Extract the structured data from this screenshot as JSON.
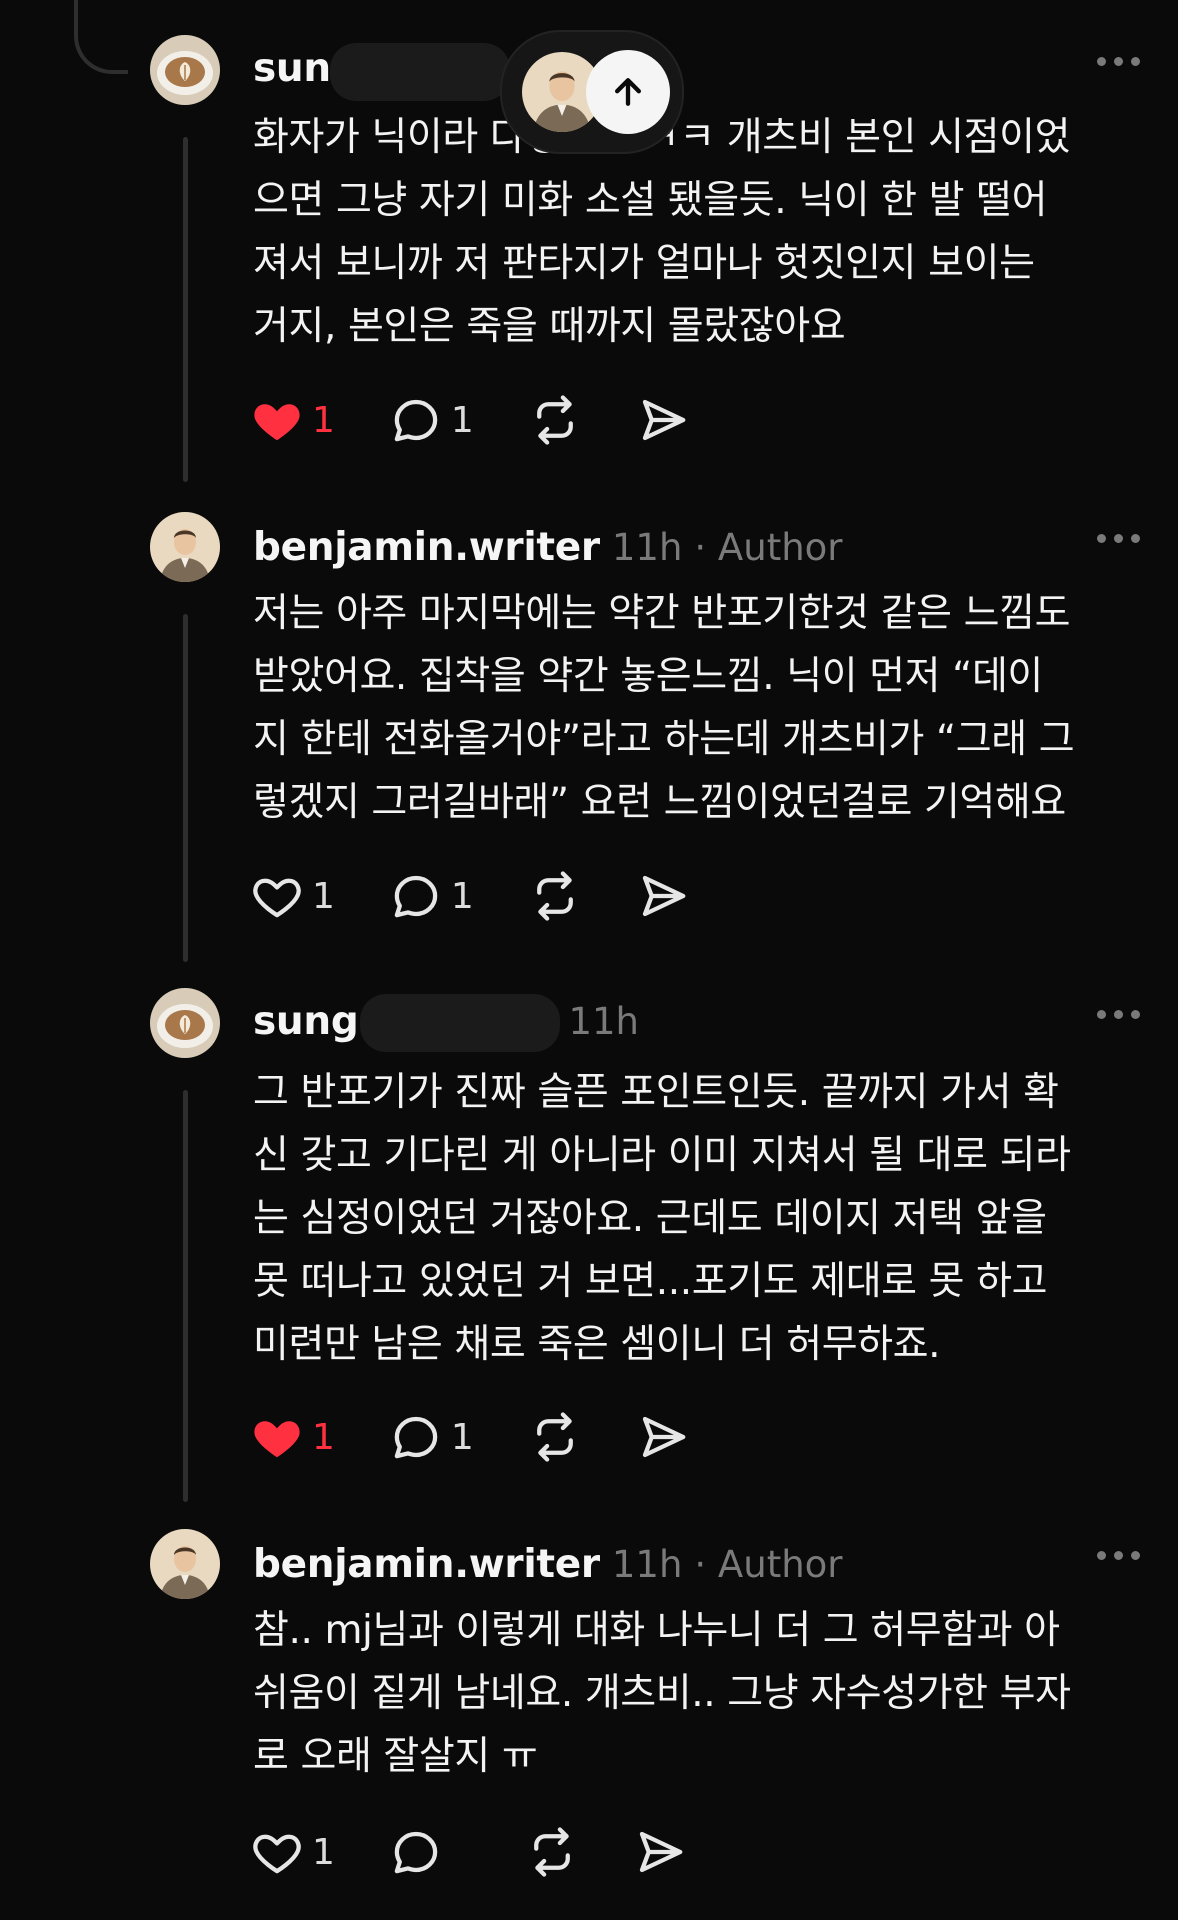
{
  "posts": [
    {
      "username": "sun",
      "time": "",
      "author_tag": "",
      "avatar": "latte-art-avatar",
      "text": "화자가 닉이라 다행이죠 ㅋㅋ 개츠비 본인 시점이었\n으면 그냥 자기 미화 소설 됐을듯. 닉이 한 발 떨어\n져서 보니까 저 판타지가 얼마나 헛짓인지 보이는\n거지, 본인은 죽을 때까지 몰랐잖아요",
      "likes": "1",
      "liked": true,
      "replies": "1"
    },
    {
      "username": "benjamin.writer",
      "time": "11h",
      "author_tag": "· Author",
      "avatar": "man-portrait-avatar",
      "text": "저는 아주 마지막에는 약간 반포기한것 같은 느낌도\n받았어요. 집착을 약간 놓은느낌. 닉이 먼저 “데이\n지 한테 전화올거야”라고 하는데 개츠비가 “그래 그\n렇겠지 그러길바래” 요런 느낌이었던걸로 기억해요",
      "likes": "1",
      "liked": false,
      "replies": "1"
    },
    {
      "username": "sung",
      "time": "11h",
      "author_tag": "",
      "avatar": "latte-art-avatar",
      "text": "그 반포기가 진짜 슬픈 포인트인듯. 끝까지 가서 확\n신 갖고 기다린 게 아니라 이미 지쳐서 될 대로 되라\n는 심정이었던 거잖아요. 근데도 데이지 저택 앞을\n못 떠나고 있었던 거 보면...포기도 제대로 못 하고\n미련만 남은 채로 죽은 셈이니 더 허무하죠.",
      "likes": "1",
      "liked": true,
      "replies": "1"
    },
    {
      "username": "benjamin.writer",
      "time": "11h",
      "author_tag": "· Author",
      "avatar": "man-portrait-avatar",
      "text": "참.. mj님과 이렇게 대화 나누니 더 그 허무함과 아\n쉬움이 짙게 남네요. 개츠비.. 그냥 자수성가한 부자\n로 오래 잘살지 ㅠ",
      "likes": "1",
      "liked": false,
      "replies": ""
    }
  ],
  "icons": {
    "like": "heart-icon",
    "reply": "comment-bubble-icon",
    "repost": "repost-icon",
    "share": "send-icon",
    "more": "more-dots-icon",
    "scroll_top": "arrow-up-icon"
  },
  "colors": {
    "background": "#0a0a0a",
    "text": "#f3f3f3",
    "muted": "#7a7a7a",
    "like_red": "#ff3040",
    "thread_line": "#2e2e2e"
  }
}
